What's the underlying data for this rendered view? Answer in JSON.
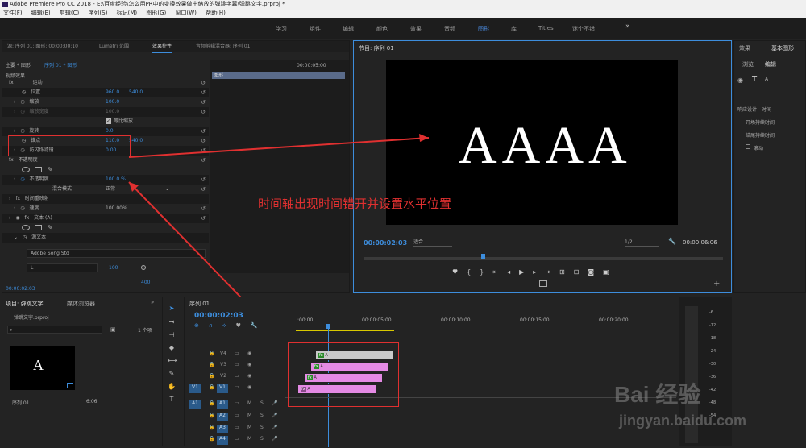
{
  "app": {
    "title": "Adobe Premiere Pro CC 2018 - E:\\百度经验\\怎么用PR中的变换效果做出缩放的弹跳字幕\\弹跳文字.prproj *"
  },
  "menu": [
    "文件(F)",
    "编辑(E)",
    "剪辑(C)",
    "序列(S)",
    "标记(M)",
    "图形(G)",
    "窗口(W)",
    "帮助(H)"
  ],
  "workspaces": [
    "学习",
    "组件",
    "编辑",
    "颜色",
    "效果",
    "音频",
    "图形",
    "库",
    "Titles",
    "迷个不错"
  ],
  "workspace_more": "»",
  "effect_panel": {
    "tabs": [
      "源: 序列 01: 图形: 00:00:00:10",
      "Lumetri 范围",
      "效果控件",
      "音频剪辑混合器: 序列 01"
    ],
    "master": "主要 * 图形",
    "sequence": "序列 01 * 图形",
    "clip_label": "图形",
    "ruler_time": "00:00:05:00",
    "section": "视频效果",
    "rows": [
      {
        "name": "运动",
        "v1": "",
        "v2": ""
      },
      {
        "name": "位置",
        "v1": "960.0",
        "v2": "540.0"
      },
      {
        "name": "缩放",
        "v1": "100.0",
        "v2": ""
      },
      {
        "name": "缩放宽度",
        "v1": "100.0",
        "v2": ""
      },
      {
        "name": "等比缩放",
        "v1": "",
        "v2": ""
      },
      {
        "name": "旋转",
        "v1": "0.0",
        "v2": ""
      },
      {
        "name": "锚点",
        "v1": "110.0",
        "v2": "540.0"
      },
      {
        "name": "防闪烁滤镜",
        "v1": "0.00",
        "v2": ""
      },
      {
        "name": "不透明度",
        "v1": "",
        "v2": ""
      },
      {
        "name": "不透明度",
        "v1": "100.0 %",
        "v2": ""
      },
      {
        "name": "混合模式",
        "v1": "正常",
        "v2": ""
      },
      {
        "name": "时间重映射",
        "v1": "",
        "v2": ""
      },
      {
        "name": "速度",
        "v1": "100.00%",
        "v2": ""
      },
      {
        "name": "文本 (A)",
        "v1": "",
        "v2": ""
      },
      {
        "name": "源文本",
        "v1": "",
        "v2": ""
      }
    ],
    "font": "Adobe Song Std",
    "font_style": "L",
    "font_size": "100",
    "tracking": "400",
    "timecode": "00:00:02:03"
  },
  "program": {
    "title": "节目: 序列 01",
    "text": "AAAA",
    "annotation": "时间轴出现时间错开并设置水平位置",
    "timecode": "00:00:02:03",
    "fit": "适合",
    "res": "1/2",
    "duration": "00:00:06:06"
  },
  "right_panel": {
    "tabs": [
      "效果",
      "基本图形"
    ],
    "subtabs": [
      "浏览",
      "编辑"
    ],
    "layer": "A",
    "section": "响应设计 - 时间",
    "items": [
      "开场持续时间",
      "结尾持续时间",
      "滚动"
    ]
  },
  "project": {
    "tabs": [
      "项目: 弹跳文字",
      "媒体浏览器"
    ],
    "file": "弹跳文字.prproj",
    "count": "1 个项",
    "thumb_letter": "A",
    "clip_name": "序列 01",
    "clip_dur": "6:06"
  },
  "timeline": {
    "title": "序列 01",
    "timecode": "00:00:02:03",
    "ruler": [
      ":00:00",
      "00:00:05:00",
      "00:00:10:00",
      "00:00:15:00",
      "00:00:20:00"
    ],
    "video_tracks": [
      "V4",
      "V3",
      "V2",
      "V1"
    ],
    "audio_tracks": [
      "A1",
      "A2",
      "A3",
      "A4"
    ],
    "source_v": "V1",
    "source_a": "A1",
    "m": "M",
    "s": "S"
  },
  "watermark": {
    "logo": "Bai  经验",
    "url": "jingyan.baidu.com"
  }
}
